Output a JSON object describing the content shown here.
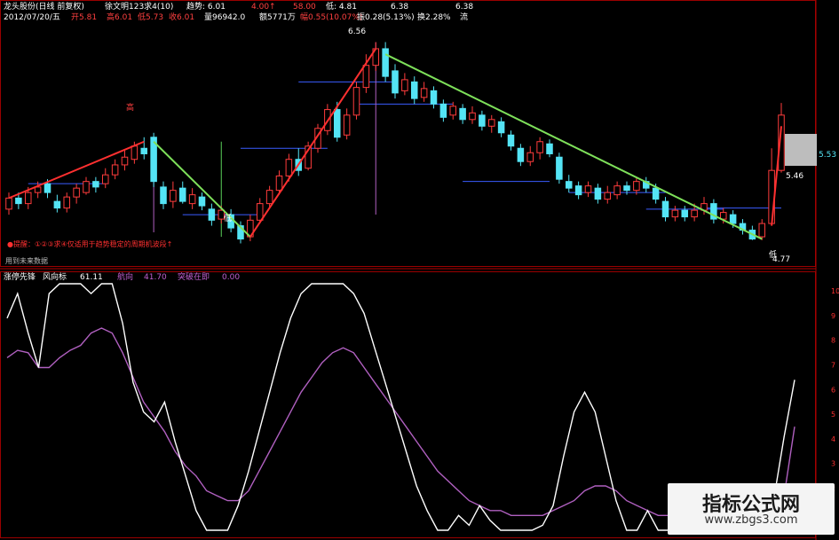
{
  "header": {
    "line1": [
      "龙头股份(日线 前复权)",
      "徐文明123求4(10)",
      "趋势: 6.01",
      "↑",
      "4.00↑",
      "58.00",
      "↑",
      "低: 4.81",
      "",
      "6.38",
      "",
      "6.38"
    ],
    "line2": [
      "2012/07/20/五",
      "开5.81",
      "高6.01",
      "低5.73",
      "收6.01",
      "量96942.0",
      "额5771万",
      "幅0.55(10.07%)",
      "振0.28(5.13%)",
      "换2.28%",
      "流"
    ]
  },
  "price_labels": {
    "peak": "6.56",
    "left_high": "高",
    "low1": "低",
    "low2": "低",
    "end_low": "4.77",
    "right_price": "5.46",
    "right_axis": "5.53"
  },
  "notes": {
    "tip": "●提醒：①②③求④仅适用于趋势稳定的周期机波段↑",
    "future": "用到未来数据"
  },
  "indicator": {
    "title": "涨停先锋",
    "line1_name": "风向标",
    "line1_val": "61.11",
    "line2_name": "航向",
    "line2_val": "41.70",
    "line3_name": "突破在即",
    "line3_val": "0.00"
  },
  "axis": {
    "ticks": [
      "10",
      "9",
      "8",
      "7",
      "6",
      "5",
      "4",
      "3",
      "2"
    ]
  },
  "colors": {
    "up": "#ff3c3c",
    "down": "#54e4f5",
    "trend_down": "#7ee05a",
    "trend_up": "#ff3030",
    "white_line": "#ffffff",
    "purple_line": "#b060c0",
    "support": "#3a5cff"
  },
  "watermark": {
    "cn": "指标公式网",
    "url": "www.zbgs3.com"
  },
  "chart_data": {
    "type": "candlestick",
    "candles": [
      {
        "o": 5.05,
        "c": 5.15,
        "h": 5.2,
        "l": 5.0
      },
      {
        "o": 5.15,
        "c": 5.1,
        "h": 5.2,
        "l": 5.05
      },
      {
        "o": 5.1,
        "c": 5.2,
        "h": 5.25,
        "l": 5.05
      },
      {
        "o": 5.2,
        "c": 5.25,
        "h": 5.3,
        "l": 5.15
      },
      {
        "o": 5.28,
        "c": 5.2,
        "h": 5.32,
        "l": 5.15
      },
      {
        "o": 5.12,
        "c": 5.06,
        "h": 5.18,
        "l": 5.02
      },
      {
        "o": 5.06,
        "c": 5.16,
        "h": 5.2,
        "l": 5.02
      },
      {
        "o": 5.16,
        "c": 5.24,
        "h": 5.28,
        "l": 5.1
      },
      {
        "o": 5.2,
        "c": 5.3,
        "h": 5.34,
        "l": 5.18
      },
      {
        "o": 5.3,
        "c": 5.25,
        "h": 5.34,
        "l": 5.2
      },
      {
        "o": 5.28,
        "c": 5.36,
        "h": 5.42,
        "l": 5.24
      },
      {
        "o": 5.36,
        "c": 5.45,
        "h": 5.5,
        "l": 5.32
      },
      {
        "o": 5.45,
        "c": 5.52,
        "h": 5.58,
        "l": 5.4
      },
      {
        "o": 5.5,
        "c": 5.62,
        "h": 5.66,
        "l": 5.46
      },
      {
        "o": 5.6,
        "c": 5.55,
        "h": 5.7,
        "l": 5.5
      },
      {
        "o": 5.7,
        "c": 5.3,
        "h": 5.74,
        "l": 5.25
      },
      {
        "o": 5.25,
        "c": 5.1,
        "h": 5.3,
        "l": 5.05
      },
      {
        "o": 5.12,
        "c": 5.22,
        "h": 5.3,
        "l": 5.06
      },
      {
        "o": 5.24,
        "c": 5.12,
        "h": 5.3,
        "l": 5.1
      },
      {
        "o": 5.1,
        "c": 5.18,
        "h": 5.24,
        "l": 5.05
      },
      {
        "o": 5.16,
        "c": 5.08,
        "h": 5.2,
        "l": 5.04
      },
      {
        "o": 5.05,
        "c": 4.95,
        "h": 5.1,
        "l": 4.9
      },
      {
        "o": 4.96,
        "c": 5.04,
        "h": 5.08,
        "l": 4.92
      },
      {
        "o": 5.0,
        "c": 4.88,
        "h": 5.05,
        "l": 4.84
      },
      {
        "o": 4.9,
        "c": 4.78,
        "h": 4.94,
        "l": 4.74
      },
      {
        "o": 4.8,
        "c": 4.95,
        "h": 5.0,
        "l": 4.76
      },
      {
        "o": 4.95,
        "c": 5.1,
        "h": 5.15,
        "l": 4.92
      },
      {
        "o": 5.1,
        "c": 5.22,
        "h": 5.26,
        "l": 5.06
      },
      {
        "o": 5.22,
        "c": 5.35,
        "h": 5.4,
        "l": 5.18
      },
      {
        "o": 5.35,
        "c": 5.5,
        "h": 5.55,
        "l": 5.3
      },
      {
        "o": 5.5,
        "c": 5.4,
        "h": 5.6,
        "l": 5.35
      },
      {
        "o": 5.42,
        "c": 5.62,
        "h": 5.66,
        "l": 5.4
      },
      {
        "o": 5.6,
        "c": 5.78,
        "h": 5.82,
        "l": 5.56
      },
      {
        "o": 5.76,
        "c": 5.95,
        "h": 6.0,
        "l": 5.72
      },
      {
        "o": 5.95,
        "c": 5.7,
        "h": 6.02,
        "l": 5.66
      },
      {
        "o": 5.72,
        "c": 5.9,
        "h": 5.96,
        "l": 5.68
      },
      {
        "o": 5.9,
        "c": 6.15,
        "h": 6.2,
        "l": 5.86
      },
      {
        "o": 6.15,
        "c": 6.35,
        "h": 6.45,
        "l": 6.1
      },
      {
        "o": 6.35,
        "c": 6.5,
        "h": 6.56,
        "l": 6.3
      },
      {
        "o": 6.5,
        "c": 6.25,
        "h": 6.56,
        "l": 6.2
      },
      {
        "o": 6.3,
        "c": 6.1,
        "h": 6.36,
        "l": 6.05
      },
      {
        "o": 6.12,
        "c": 6.22,
        "h": 6.28,
        "l": 6.08
      },
      {
        "o": 6.2,
        "c": 6.05,
        "h": 6.25,
        "l": 6.0
      },
      {
        "o": 6.06,
        "c": 6.14,
        "h": 6.2,
        "l": 6.02
      },
      {
        "o": 6.12,
        "c": 6.0,
        "h": 6.16,
        "l": 5.96
      },
      {
        "o": 6.0,
        "c": 5.88,
        "h": 6.04,
        "l": 5.84
      },
      {
        "o": 5.9,
        "c": 5.98,
        "h": 6.02,
        "l": 5.86
      },
      {
        "o": 5.96,
        "c": 5.86,
        "h": 6.0,
        "l": 5.82
      },
      {
        "o": 5.86,
        "c": 5.92,
        "h": 5.98,
        "l": 5.82
      },
      {
        "o": 5.9,
        "c": 5.8,
        "h": 5.94,
        "l": 5.76
      },
      {
        "o": 5.8,
        "c": 5.86,
        "h": 5.9,
        "l": 5.74
      },
      {
        "o": 5.84,
        "c": 5.74,
        "h": 5.88,
        "l": 5.7
      },
      {
        "o": 5.72,
        "c": 5.62,
        "h": 5.76,
        "l": 5.58
      },
      {
        "o": 5.6,
        "c": 5.48,
        "h": 5.64,
        "l": 5.44
      },
      {
        "o": 5.48,
        "c": 5.56,
        "h": 5.62,
        "l": 5.44
      },
      {
        "o": 5.56,
        "c": 5.66,
        "h": 5.7,
        "l": 5.5
      },
      {
        "o": 5.64,
        "c": 5.55,
        "h": 5.68,
        "l": 5.52
      },
      {
        "o": 5.52,
        "c": 5.32,
        "h": 5.56,
        "l": 5.28
      },
      {
        "o": 5.3,
        "c": 5.24,
        "h": 5.36,
        "l": 5.2
      },
      {
        "o": 5.26,
        "c": 5.18,
        "h": 5.3,
        "l": 5.14
      },
      {
        "o": 5.2,
        "c": 5.26,
        "h": 5.3,
        "l": 5.16
      },
      {
        "o": 5.24,
        "c": 5.14,
        "h": 5.28,
        "l": 5.1
      },
      {
        "o": 5.14,
        "c": 5.2,
        "h": 5.26,
        "l": 5.1
      },
      {
        "o": 5.18,
        "c": 5.26,
        "h": 5.3,
        "l": 5.14
      },
      {
        "o": 5.26,
        "c": 5.22,
        "h": 5.3,
        "l": 5.18
      },
      {
        "o": 5.22,
        "c": 5.3,
        "h": 5.34,
        "l": 5.18
      },
      {
        "o": 5.3,
        "c": 5.24,
        "h": 5.34,
        "l": 5.2
      },
      {
        "o": 5.24,
        "c": 5.14,
        "h": 5.28,
        "l": 5.1
      },
      {
        "o": 5.12,
        "c": 4.98,
        "h": 5.16,
        "l": 4.94
      },
      {
        "o": 4.98,
        "c": 5.04,
        "h": 5.08,
        "l": 4.94
      },
      {
        "o": 5.04,
        "c": 4.98,
        "h": 5.08,
        "l": 4.94
      },
      {
        "o": 4.98,
        "c": 5.04,
        "h": 5.1,
        "l": 4.94
      },
      {
        "o": 5.04,
        "c": 5.1,
        "h": 5.16,
        "l": 5.0
      },
      {
        "o": 5.1,
        "c": 4.96,
        "h": 5.14,
        "l": 4.92
      },
      {
        "o": 4.96,
        "c": 5.02,
        "h": 5.06,
        "l": 4.92
      },
      {
        "o": 5.0,
        "c": 4.92,
        "h": 5.04,
        "l": 4.88
      },
      {
        "o": 4.92,
        "c": 4.86,
        "h": 4.96,
        "l": 4.82
      },
      {
        "o": 4.86,
        "c": 4.78,
        "h": 4.9,
        "l": 4.77
      },
      {
        "o": 4.8,
        "c": 4.92,
        "h": 4.96,
        "l": 4.77
      },
      {
        "o": 4.92,
        "c": 5.4,
        "h": 5.6,
        "l": 4.9
      },
      {
        "o": 5.4,
        "c": 5.9,
        "h": 6.01,
        "l": 5.38
      }
    ],
    "ylim": [
      4.6,
      6.7
    ],
    "indicator_ylim": [
      0,
      100
    ],
    "line_white": [
      86,
      96,
      80,
      66,
      96,
      100,
      100,
      100,
      96,
      100,
      100,
      84,
      60,
      48,
      44,
      52,
      36,
      22,
      8,
      0,
      0,
      0,
      10,
      24,
      40,
      56,
      72,
      86,
      96,
      100,
      100,
      100,
      100,
      96,
      88,
      74,
      60,
      46,
      32,
      18,
      8,
      0,
      0,
      6,
      2,
      10,
      4,
      0,
      0,
      0,
      0,
      2,
      10,
      30,
      48,
      56,
      48,
      30,
      12,
      0,
      0,
      8,
      0,
      0,
      10,
      6,
      0,
      0,
      4,
      10,
      6,
      0,
      0,
      12,
      38,
      61
    ],
    "line_purple": [
      70,
      73,
      72,
      66,
      66,
      70,
      73,
      75,
      80,
      82,
      80,
      72,
      62,
      52,
      46,
      40,
      32,
      26,
      22,
      16,
      14,
      12,
      12,
      16,
      24,
      32,
      40,
      48,
      56,
      62,
      68,
      72,
      74,
      72,
      66,
      60,
      54,
      48,
      42,
      36,
      30,
      24,
      20,
      16,
      12,
      10,
      8,
      8,
      6,
      6,
      6,
      6,
      8,
      10,
      12,
      16,
      18,
      18,
      16,
      12,
      10,
      8,
      6,
      6,
      6,
      6,
      4,
      4,
      4,
      6,
      6,
      6,
      4,
      6,
      14,
      42
    ]
  }
}
